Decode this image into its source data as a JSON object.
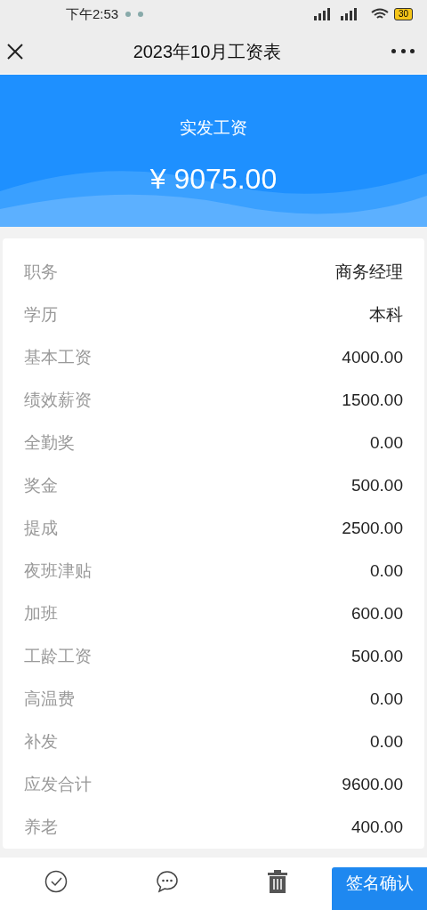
{
  "status_bar": {
    "time": "下午2:53",
    "battery": "30"
  },
  "header": {
    "title": "2023年10月工资表"
  },
  "banner": {
    "label": "实发工资",
    "amount": "¥ 9075.00"
  },
  "rows": [
    {
      "label": "职务",
      "value": "商务经理"
    },
    {
      "label": "学历",
      "value": "本科"
    },
    {
      "label": "基本工资",
      "value": "4000.00"
    },
    {
      "label": "绩效薪资",
      "value": "1500.00"
    },
    {
      "label": "全勤奖",
      "value": "0.00"
    },
    {
      "label": "奖金",
      "value": "500.00"
    },
    {
      "label": "提成",
      "value": "2500.00"
    },
    {
      "label": "夜班津贴",
      "value": "0.00"
    },
    {
      "label": "加班",
      "value": "600.00"
    },
    {
      "label": "工龄工资",
      "value": "500.00"
    },
    {
      "label": "高温费",
      "value": "0.00"
    },
    {
      "label": "补发",
      "value": "0.00"
    },
    {
      "label": "应发合计",
      "value": "9600.00"
    },
    {
      "label": "养老",
      "value": "400.00"
    }
  ],
  "bottom_bar": {
    "confirm_button": "签名确认"
  }
}
